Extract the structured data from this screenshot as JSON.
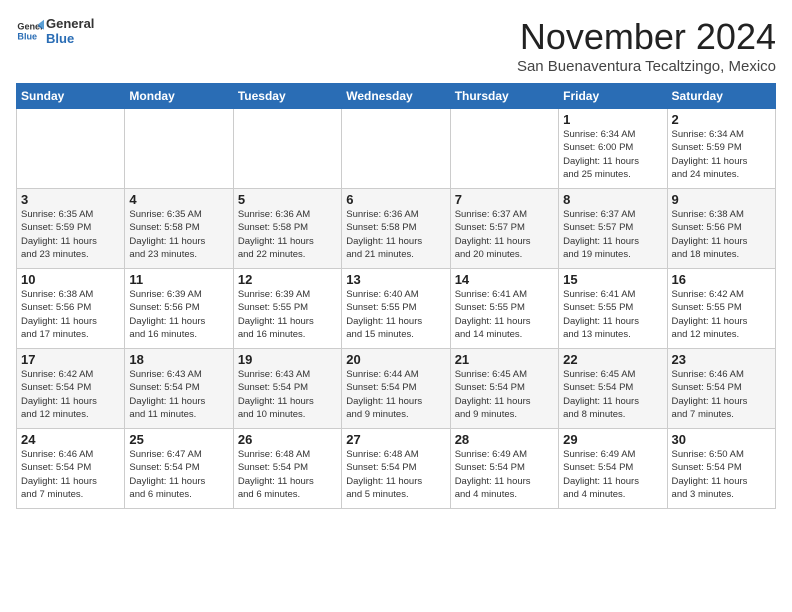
{
  "header": {
    "logo_general": "General",
    "logo_blue": "Blue",
    "month_title": "November 2024",
    "location": "San Buenaventura Tecaltzingo, Mexico"
  },
  "weekdays": [
    "Sunday",
    "Monday",
    "Tuesday",
    "Wednesday",
    "Thursday",
    "Friday",
    "Saturday"
  ],
  "weeks": [
    [
      {
        "day": "",
        "info": ""
      },
      {
        "day": "",
        "info": ""
      },
      {
        "day": "",
        "info": ""
      },
      {
        "day": "",
        "info": ""
      },
      {
        "day": "",
        "info": ""
      },
      {
        "day": "1",
        "info": "Sunrise: 6:34 AM\nSunset: 6:00 PM\nDaylight: 11 hours\nand 25 minutes."
      },
      {
        "day": "2",
        "info": "Sunrise: 6:34 AM\nSunset: 5:59 PM\nDaylight: 11 hours\nand 24 minutes."
      }
    ],
    [
      {
        "day": "3",
        "info": "Sunrise: 6:35 AM\nSunset: 5:59 PM\nDaylight: 11 hours\nand 23 minutes."
      },
      {
        "day": "4",
        "info": "Sunrise: 6:35 AM\nSunset: 5:58 PM\nDaylight: 11 hours\nand 23 minutes."
      },
      {
        "day": "5",
        "info": "Sunrise: 6:36 AM\nSunset: 5:58 PM\nDaylight: 11 hours\nand 22 minutes."
      },
      {
        "day": "6",
        "info": "Sunrise: 6:36 AM\nSunset: 5:58 PM\nDaylight: 11 hours\nand 21 minutes."
      },
      {
        "day": "7",
        "info": "Sunrise: 6:37 AM\nSunset: 5:57 PM\nDaylight: 11 hours\nand 20 minutes."
      },
      {
        "day": "8",
        "info": "Sunrise: 6:37 AM\nSunset: 5:57 PM\nDaylight: 11 hours\nand 19 minutes."
      },
      {
        "day": "9",
        "info": "Sunrise: 6:38 AM\nSunset: 5:56 PM\nDaylight: 11 hours\nand 18 minutes."
      }
    ],
    [
      {
        "day": "10",
        "info": "Sunrise: 6:38 AM\nSunset: 5:56 PM\nDaylight: 11 hours\nand 17 minutes."
      },
      {
        "day": "11",
        "info": "Sunrise: 6:39 AM\nSunset: 5:56 PM\nDaylight: 11 hours\nand 16 minutes."
      },
      {
        "day": "12",
        "info": "Sunrise: 6:39 AM\nSunset: 5:55 PM\nDaylight: 11 hours\nand 16 minutes."
      },
      {
        "day": "13",
        "info": "Sunrise: 6:40 AM\nSunset: 5:55 PM\nDaylight: 11 hours\nand 15 minutes."
      },
      {
        "day": "14",
        "info": "Sunrise: 6:41 AM\nSunset: 5:55 PM\nDaylight: 11 hours\nand 14 minutes."
      },
      {
        "day": "15",
        "info": "Sunrise: 6:41 AM\nSunset: 5:55 PM\nDaylight: 11 hours\nand 13 minutes."
      },
      {
        "day": "16",
        "info": "Sunrise: 6:42 AM\nSunset: 5:55 PM\nDaylight: 11 hours\nand 12 minutes."
      }
    ],
    [
      {
        "day": "17",
        "info": "Sunrise: 6:42 AM\nSunset: 5:54 PM\nDaylight: 11 hours\nand 12 minutes."
      },
      {
        "day": "18",
        "info": "Sunrise: 6:43 AM\nSunset: 5:54 PM\nDaylight: 11 hours\nand 11 minutes."
      },
      {
        "day": "19",
        "info": "Sunrise: 6:43 AM\nSunset: 5:54 PM\nDaylight: 11 hours\nand 10 minutes."
      },
      {
        "day": "20",
        "info": "Sunrise: 6:44 AM\nSunset: 5:54 PM\nDaylight: 11 hours\nand 9 minutes."
      },
      {
        "day": "21",
        "info": "Sunrise: 6:45 AM\nSunset: 5:54 PM\nDaylight: 11 hours\nand 9 minutes."
      },
      {
        "day": "22",
        "info": "Sunrise: 6:45 AM\nSunset: 5:54 PM\nDaylight: 11 hours\nand 8 minutes."
      },
      {
        "day": "23",
        "info": "Sunrise: 6:46 AM\nSunset: 5:54 PM\nDaylight: 11 hours\nand 7 minutes."
      }
    ],
    [
      {
        "day": "24",
        "info": "Sunrise: 6:46 AM\nSunset: 5:54 PM\nDaylight: 11 hours\nand 7 minutes."
      },
      {
        "day": "25",
        "info": "Sunrise: 6:47 AM\nSunset: 5:54 PM\nDaylight: 11 hours\nand 6 minutes."
      },
      {
        "day": "26",
        "info": "Sunrise: 6:48 AM\nSunset: 5:54 PM\nDaylight: 11 hours\nand 6 minutes."
      },
      {
        "day": "27",
        "info": "Sunrise: 6:48 AM\nSunset: 5:54 PM\nDaylight: 11 hours\nand 5 minutes."
      },
      {
        "day": "28",
        "info": "Sunrise: 6:49 AM\nSunset: 5:54 PM\nDaylight: 11 hours\nand 4 minutes."
      },
      {
        "day": "29",
        "info": "Sunrise: 6:49 AM\nSunset: 5:54 PM\nDaylight: 11 hours\nand 4 minutes."
      },
      {
        "day": "30",
        "info": "Sunrise: 6:50 AM\nSunset: 5:54 PM\nDaylight: 11 hours\nand 3 minutes."
      }
    ]
  ]
}
